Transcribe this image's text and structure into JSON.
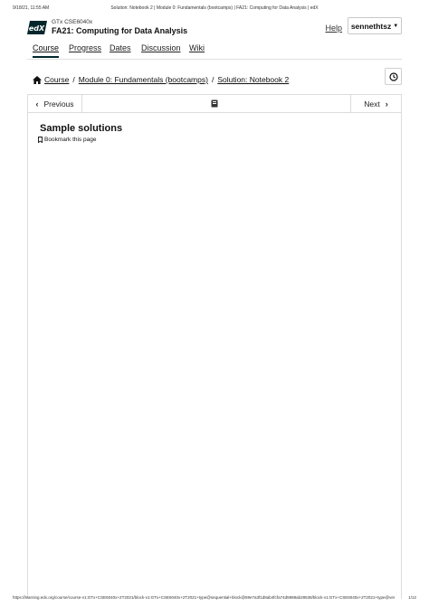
{
  "print_header": {
    "datetime": "9/18/21, 11:55 AM",
    "page_title": "Solution: Notebook 2 | Module 0: Fundamentals (bootcamps) | FA21: Computing for Data Analysis | edX"
  },
  "header": {
    "logo_text": "edX",
    "org": "GTx CSE6040x",
    "course_title": "FA21: Computing for Data Analysis",
    "help_label": "Help",
    "username": "sennethtsz"
  },
  "nav": {
    "tabs": [
      {
        "label": "Course",
        "active": true
      },
      {
        "label": "Progress"
      },
      {
        "label": "Dates"
      },
      {
        "label": "Discussion"
      },
      {
        "label": "Wiki"
      }
    ]
  },
  "breadcrumb": {
    "items": [
      "Course",
      "Module 0: Fundamentals (bootcamps)",
      "Solution: Notebook 2"
    ],
    "separator": "/"
  },
  "sequence_nav": {
    "previous_label": "Previous",
    "next_label": "Next"
  },
  "unit": {
    "title": "Sample solutions",
    "bookmark_label": "Bookmark this page"
  },
  "print_footer": {
    "url": "https://learning.edx.org/course/course-v1:GTx+CSE6040x+2T2021/block-v1:GTx+CSE6040x+2T2021+type@sequential+block@59e7a3f1d8ab4fcfa74d5988ab28538/block-v1:GTx+CSE6040x+2T2021+type@vert…",
    "page": "1/12"
  },
  "colors": {
    "accent": "#00262b",
    "logo_bg": "#02262b"
  },
  "icons": {
    "home": "home-icon",
    "clock": "clock-icon",
    "unit": "book-icon",
    "bookmark": "bookmark-icon",
    "prev": "chevron-left-icon",
    "next": "chevron-right-icon",
    "user_menu": "caret-down-icon"
  }
}
